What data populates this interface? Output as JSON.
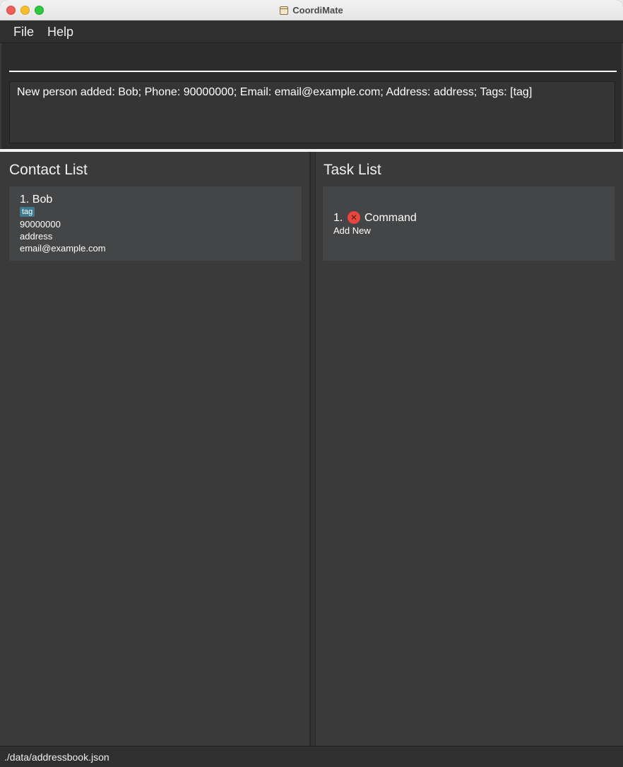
{
  "window": {
    "title": "CoordiMate"
  },
  "menu": {
    "file_label": "File",
    "help_label": "Help"
  },
  "command": {
    "value": "",
    "placeholder": ""
  },
  "result": {
    "text": "New person added: Bob; Phone: 90000000; Email: email@example.com; Address: address; Tags: [tag]"
  },
  "contacts": {
    "title": "Contact List",
    "items": [
      {
        "index_name": "1.  Bob",
        "tag": "tag",
        "phone": "90000000",
        "address": "address",
        "email": "email@example.com"
      }
    ]
  },
  "tasks": {
    "title": "Task List",
    "items": [
      {
        "index": "1.",
        "status_icon": "x-circle-icon",
        "status_color": "#e8473f",
        "name": "Command",
        "description": "Add New"
      }
    ]
  },
  "status_bar": {
    "path": "./data/addressbook.json"
  },
  "colors": {
    "background": "#3a3a3a",
    "card": "#444546",
    "tag": "#3e7b91"
  }
}
